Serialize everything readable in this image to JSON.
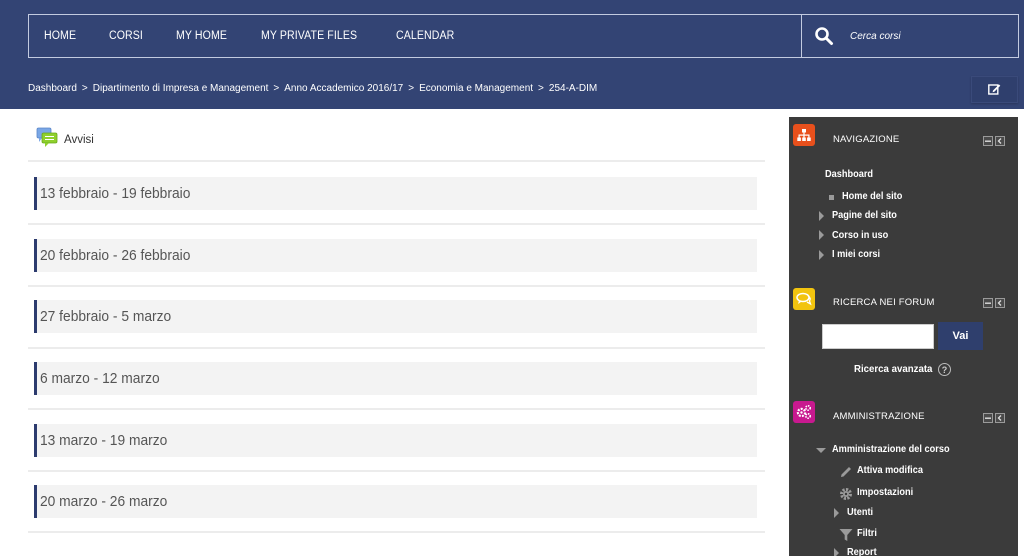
{
  "header": {
    "nav_items": [
      "HOME",
      "CORSI",
      "MY HOME",
      "MY PRIVATE FILES",
      "CALENDAR"
    ],
    "search": {
      "placeholder": "Cerca corsi",
      "value": "",
      "icon": "search-icon"
    },
    "breadcrumb": [
      "Dashboard",
      "Dipartimento di Impresa e Management",
      "Anno Accademico 2016/17",
      "Economia e Management",
      "254-A-DIM"
    ],
    "breadcrumb_separator": ">",
    "edit_button_icon": "edit-icon"
  },
  "main": {
    "announcements": {
      "label": "Avvisi",
      "icon": "forum-icon"
    },
    "weeks": [
      "13 febbraio - 19 febbraio",
      "20 febbraio - 26 febbraio",
      "27 febbraio - 5 marzo",
      "6 marzo - 12 marzo",
      "13 marzo - 19 marzo",
      "20 marzo - 26 marzo"
    ]
  },
  "sidebar": {
    "navigation": {
      "title": "NAVIGAZIONE",
      "icon": "sitemap-icon",
      "icon_color": "#e8501c",
      "items": {
        "dashboard": "Dashboard",
        "home": "Home del sito",
        "pages": "Pagine del sito",
        "current_course": "Corso in uso",
        "my_courses": "I miei corsi"
      }
    },
    "forum_search": {
      "title": "RICERCA NEI FORUM",
      "icon": "chat-icon",
      "icon_color": "#f2c40f",
      "input_value": "",
      "button_label": "Vai",
      "advanced_label": "Ricerca avanzata",
      "help_glyph": "?"
    },
    "administration": {
      "title": "AMMINISTRAZIONE",
      "icon": "gears-icon",
      "icon_color": "#c8198f",
      "items": {
        "course_admin": "Amministrazione del corso",
        "edit_mode": "Attiva modifica",
        "settings": "Impostazioni",
        "users": "Utenti",
        "filters": "Filtri",
        "report": "Report"
      }
    }
  },
  "colors": {
    "header_bg": "#334474",
    "sidebar_bg": "#3b3b3b",
    "week_accent": "#2c3b6e",
    "button_bg": "#2f3f6d"
  }
}
